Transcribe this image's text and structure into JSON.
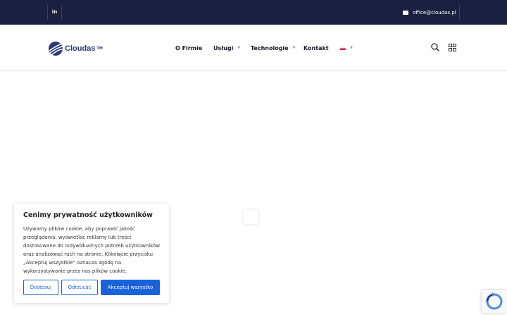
{
  "topbar": {
    "linkedin_label": "in",
    "email": "office@cloudas.pl"
  },
  "logo": {
    "name": "Cloudas",
    "tm": "TM"
  },
  "nav": {
    "items": [
      {
        "label": "O Firmie"
      },
      {
        "label": "Usługi"
      },
      {
        "label": "Technologie"
      },
      {
        "label": "Kontakt"
      }
    ]
  },
  "cookie": {
    "title": "Cenimy prywatność użytkowników",
    "body": "Używamy plików cookie, aby poprawić jakość przeglądania, wyświetlać reklamy lub treści dostosowane do indywidualnych potrzeb użytkowników oraz analizować ruch na stronie. Kliknięcie przycisku „Akceptuj wszystkie” oznacza zgodę na wykorzystywanie przez nas plików cookie.",
    "customize": "Dostosuj",
    "reject": "Odrzucać",
    "accept": "Akceptuj wszystko"
  },
  "colors": {
    "topbar": "#1a2040",
    "accent": "#1863dc",
    "logo": "#2a3a7a"
  }
}
